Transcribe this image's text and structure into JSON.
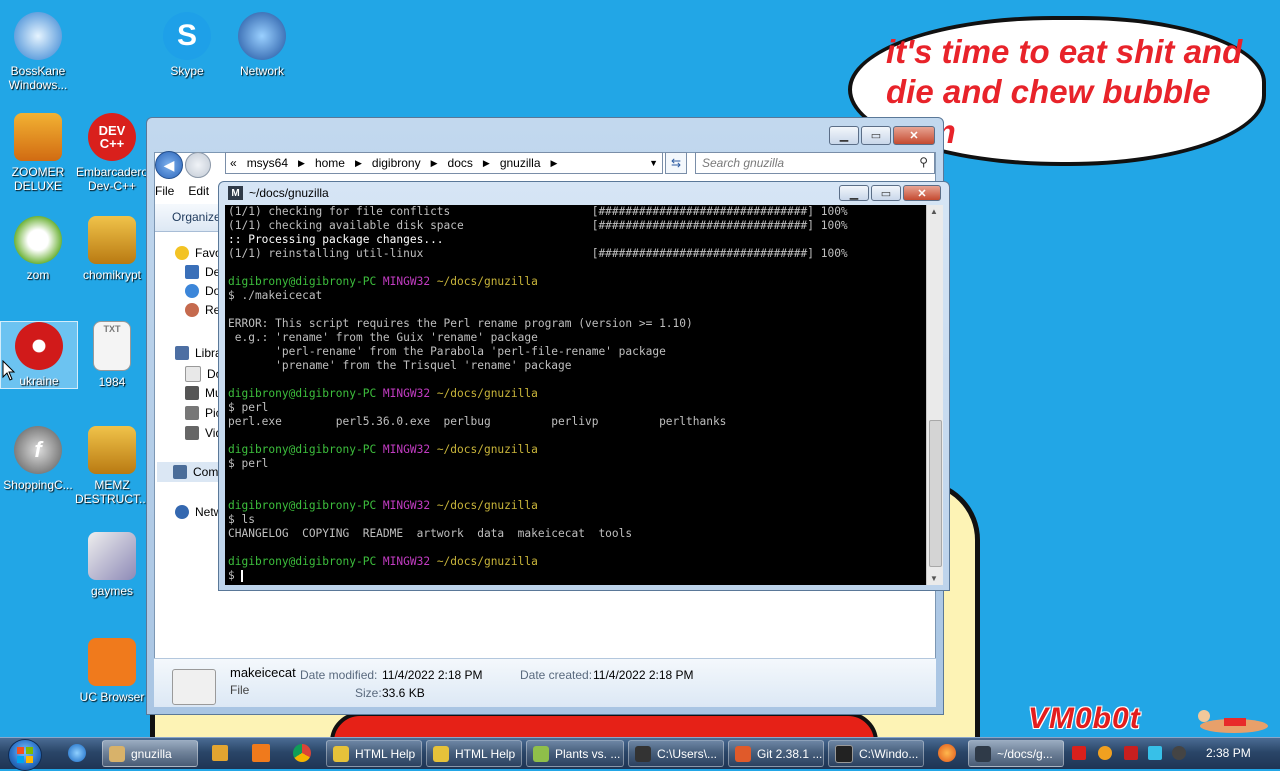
{
  "wallpaper": {
    "speech_bubble": "it's time to eat shit and die and chew bubble gum",
    "logo_text": "VM0b0t"
  },
  "desktop_icons": [
    {
      "label": "BossKane Windows...",
      "icon": "bosskane-icon"
    },
    {
      "label": "Skype",
      "icon": "skype-icon"
    },
    {
      "label": "Network",
      "icon": "network-icon"
    },
    {
      "label": "ZOOMER DELUXE",
      "icon": "zoomer-icon"
    },
    {
      "label": "Embarcadero Dev-C++",
      "icon": "devcpp-icon",
      "badge": "DEV C++"
    },
    {
      "label": "zom",
      "icon": "flower-icon"
    },
    {
      "label": "chomikrypt",
      "icon": "clock-app-icon"
    },
    {
      "label": "ukraine",
      "icon": "radiation-icon"
    },
    {
      "label": "1984",
      "icon": "text-file-icon",
      "badge": "TXT"
    },
    {
      "label": "ShoppingC...",
      "icon": "flash-icon"
    },
    {
      "label": "MEMZ DESTRUCT...",
      "icon": "clock-app-icon"
    },
    {
      "label": "gaymes",
      "icon": "media-icon"
    },
    {
      "label": "UC Browser",
      "icon": "uc-browser-icon"
    }
  ],
  "explorer": {
    "address": {
      "prefix": "«",
      "crumbs": [
        "msys64",
        "home",
        "digibrony",
        "docs",
        "gnuzilla"
      ]
    },
    "search_placeholder": "Search gnuzilla",
    "menu": [
      "File",
      "Edit"
    ],
    "organize": "Organize",
    "nav": [
      "Favo",
      "De",
      "Do",
      "Re",
      "Libra",
      "Do",
      "Mu",
      "Pic",
      "Vid",
      "Com",
      "Netw"
    ],
    "details": {
      "name": "makeicecat",
      "type": "File",
      "date_modified_label": "Date modified:",
      "date_modified": "11/4/2022 2:18 PM",
      "date_created_label": "Date created:",
      "date_created": "11/4/2022 2:18 PM",
      "size_label": "Size:",
      "size": "33.6 KB"
    }
  },
  "terminal": {
    "title": "~/docs/gnuzilla",
    "lines": [
      [
        {
          "t": "(1/1) checking for file conflicts                     [###############################] 100%",
          "c": ""
        }
      ],
      [
        {
          "t": "(1/1) checking available disk space                   [###############################] 100%",
          "c": ""
        }
      ],
      [
        {
          "t": ":: Processing package changes...",
          "c": "c-wht"
        }
      ],
      [
        {
          "t": "(1/1) reinstalling util-linux                         [###############################] 100%",
          "c": ""
        }
      ],
      [
        {
          "t": "",
          "c": ""
        }
      ],
      [
        {
          "t": "digibrony@digibrony-PC ",
          "c": "c-green"
        },
        {
          "t": "MINGW32 ",
          "c": "c-mag"
        },
        {
          "t": "~/docs/gnuzilla",
          "c": "c-yel"
        }
      ],
      [
        {
          "t": "$ ./makeicecat",
          "c": ""
        }
      ],
      [
        {
          "t": "",
          "c": ""
        }
      ],
      [
        {
          "t": "ERROR: This script requires the Perl rename program (version >= 1.10)",
          "c": ""
        }
      ],
      [
        {
          "t": " e.g.: 'rename' from the Guix 'rename' package",
          "c": ""
        }
      ],
      [
        {
          "t": "       'perl-rename' from the Parabola 'perl-file-rename' package",
          "c": ""
        }
      ],
      [
        {
          "t": "       'prename' from the Trisquel 'rename' package",
          "c": ""
        }
      ],
      [
        {
          "t": "",
          "c": ""
        }
      ],
      [
        {
          "t": "digibrony@digibrony-PC ",
          "c": "c-green"
        },
        {
          "t": "MINGW32 ",
          "c": "c-mag"
        },
        {
          "t": "~/docs/gnuzilla",
          "c": "c-yel"
        }
      ],
      [
        {
          "t": "$ perl",
          "c": ""
        }
      ],
      [
        {
          "t": "perl.exe        perl5.36.0.exe  perlbug         perlivp         perlthanks",
          "c": ""
        }
      ],
      [
        {
          "t": "",
          "c": ""
        }
      ],
      [
        {
          "t": "digibrony@digibrony-PC ",
          "c": "c-green"
        },
        {
          "t": "MINGW32 ",
          "c": "c-mag"
        },
        {
          "t": "~/docs/gnuzilla",
          "c": "c-yel"
        }
      ],
      [
        {
          "t": "$ perl",
          "c": ""
        }
      ],
      [
        {
          "t": "",
          "c": ""
        }
      ],
      [
        {
          "t": "",
          "c": ""
        }
      ],
      [
        {
          "t": "digibrony@digibrony-PC ",
          "c": "c-green"
        },
        {
          "t": "MINGW32 ",
          "c": "c-mag"
        },
        {
          "t": "~/docs/gnuzilla",
          "c": "c-yel"
        }
      ],
      [
        {
          "t": "$ ls",
          "c": ""
        }
      ],
      [
        {
          "t": "CHANGELOG  COPYING  README  artwork  data  makeicecat  tools",
          "c": ""
        }
      ],
      [
        {
          "t": "",
          "c": ""
        }
      ],
      [
        {
          "t": "digibrony@digibrony-PC ",
          "c": "c-green"
        },
        {
          "t": "MINGW32 ",
          "c": "c-mag"
        },
        {
          "t": "~/docs/gnuzilla",
          "c": "c-yel"
        }
      ],
      [
        {
          "t": "$ ",
          "c": ""
        },
        {
          "t": "",
          "c": "cursor"
        }
      ]
    ]
  },
  "taskbar": {
    "buttons": [
      {
        "label": "gnuzilla",
        "color": "#d8b26a"
      },
      {
        "label": "HTML Help",
        "color": "#e6c23a"
      },
      {
        "label": "HTML Help",
        "color": "#e6c23a"
      },
      {
        "label": "Plants vs. ...",
        "color": "#8fbf4a"
      },
      {
        "label": "C:\\Users\\...",
        "color": "#333333"
      },
      {
        "label": "Git 2.38.1 ...",
        "color": "#e05a2a"
      },
      {
        "label": "C:\\Windo...",
        "color": "#222222"
      },
      {
        "label": "~/docs/g...",
        "color": "#2f3a48"
      }
    ],
    "clock": "2:38 PM"
  }
}
